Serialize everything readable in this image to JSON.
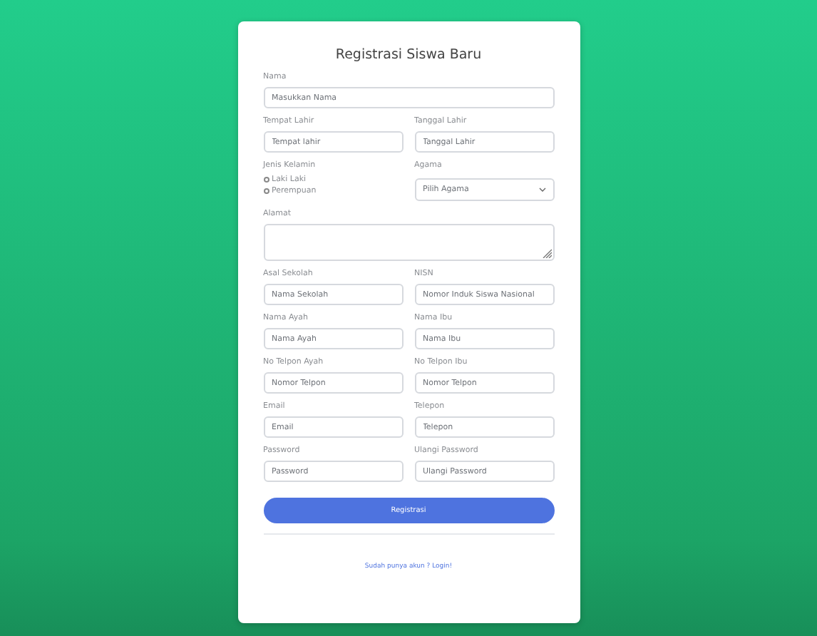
{
  "title": "Registrasi Siswa Baru",
  "rows": [
    {
      "fields": [
        {
          "label": "Nama",
          "kind": "input",
          "placeholder": "Masukkan Nama"
        }
      ]
    },
    {
      "fields": [
        {
          "label": "Tempat Lahir",
          "kind": "input",
          "placeholder": "Tempat lahir"
        },
        {
          "label": "Tanggal Lahir",
          "kind": "input",
          "placeholder": "Tanggal Lahir"
        }
      ]
    },
    {
      "fields": [
        {
          "label": "Jenis Kelamin",
          "kind": "radio",
          "options": [
            {
              "label": "Laki Laki",
              "selected": false
            },
            {
              "label": "Perempuan",
              "selected": false
            }
          ]
        },
        {
          "label": "Agama",
          "kind": "select",
          "value": "Pilih Agama"
        }
      ]
    },
    {
      "fields": [
        {
          "label": "Alamat",
          "kind": "textarea"
        }
      ]
    },
    {
      "fields": [
        {
          "label": "Asal Sekolah",
          "kind": "input",
          "placeholder": "Nama Sekolah"
        },
        {
          "label": "NISN",
          "kind": "input",
          "placeholder": "Nomor Induk Siswa Nasional"
        }
      ]
    },
    {
      "fields": [
        {
          "label": "Nama Ayah",
          "kind": "input",
          "placeholder": "Nama Ayah"
        },
        {
          "label": "Nama Ibu",
          "kind": "input",
          "placeholder": "Nama Ibu"
        }
      ]
    },
    {
      "fields": [
        {
          "label": "No Telpon Ayah",
          "kind": "input",
          "placeholder": "Nomor Telpon"
        },
        {
          "label": "No Telpon Ibu",
          "kind": "input",
          "placeholder": "Nomor Telpon"
        }
      ]
    },
    {
      "fields": [
        {
          "label": "Email",
          "kind": "input",
          "placeholder": "Email"
        },
        {
          "label": "Telepon",
          "kind": "input",
          "placeholder": "Telepon"
        }
      ]
    },
    {
      "fields": [
        {
          "label": "Password",
          "kind": "input",
          "placeholder": "Password"
        },
        {
          "label": "Ulangi Password",
          "kind": "input",
          "placeholder": "Ulangi Password"
        }
      ]
    }
  ],
  "submit": "Registrasi",
  "login_link": "Sudah punya akun ? Login!"
}
